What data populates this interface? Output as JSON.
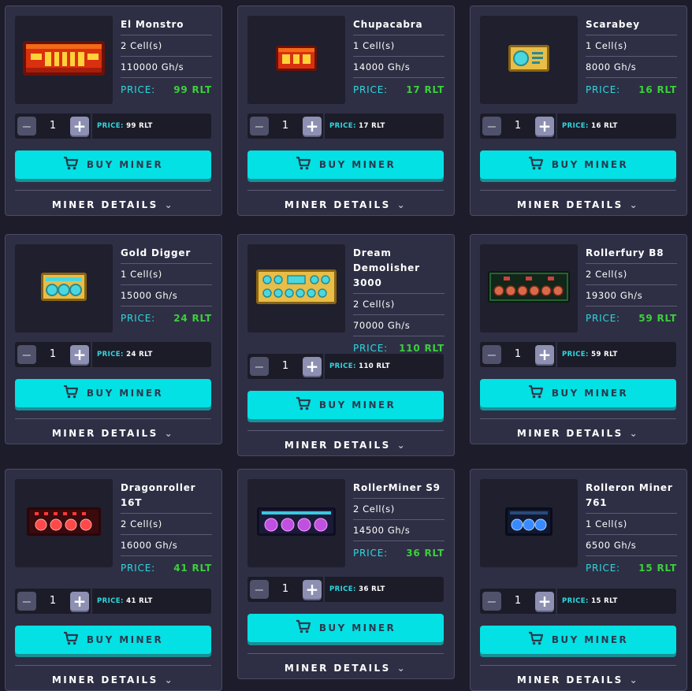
{
  "labels": {
    "price": "PRICE:",
    "buy": "BUY MINER",
    "details": "MINER DETAILS",
    "minus": "−",
    "plus": "+"
  },
  "miners": [
    {
      "name": "El Monstro",
      "cells": "2 Cell(s)",
      "power": "110000 Gh/s",
      "price": "99 RLT",
      "qty": "1",
      "icon": "red-gold-miner-icon"
    },
    {
      "name": "Chupacabra",
      "cells": "1 Cell(s)",
      "power": "14000 Gh/s",
      "price": "17 RLT",
      "qty": "1",
      "icon": "red-small-miner-icon"
    },
    {
      "name": "Scarabey",
      "cells": "1 Cell(s)",
      "power": "8000 Gh/s",
      "price": "16 RLT",
      "qty": "1",
      "icon": "gold-scarab-miner-icon"
    },
    {
      "name": "Gold Digger",
      "cells": "1 Cell(s)",
      "power": "15000 Gh/s",
      "price": "24 RLT",
      "qty": "1",
      "icon": "gold-fan-miner-icon"
    },
    {
      "name": "Dream Demolisher 3000",
      "cells": "2 Cell(s)",
      "power": "70000 Gh/s",
      "price": "110 RLT",
      "qty": "1",
      "icon": "gold-large-miner-icon"
    },
    {
      "name": "Rollerfury B8",
      "cells": "2 Cell(s)",
      "power": "19300 Gh/s",
      "price": "59 RLT",
      "qty": "1",
      "icon": "dark-green-miner-icon"
    },
    {
      "name": "Dragonroller 16T",
      "cells": "2 Cell(s)",
      "power": "16000 Gh/s",
      "price": "41 RLT",
      "qty": "1",
      "icon": "red-led-miner-icon"
    },
    {
      "name": "RollerMiner S9",
      "cells": "2 Cell(s)",
      "power": "14500 Gh/s",
      "price": "36 RLT",
      "qty": "1",
      "icon": "purple-fan-miner-icon"
    },
    {
      "name": "Rolleron Miner 761",
      "cells": "1 Cell(s)",
      "power": "6500 Gh/s",
      "price": "15 RLT",
      "qty": "1",
      "icon": "blue-fan-miner-icon"
    }
  ],
  "colors": {
    "accent": "#03e1e4",
    "price_label": "#2fd8e0",
    "price_value": "#3ccf3c",
    "card_bg": "#2e2f44",
    "page_bg": "#1c1c2b"
  }
}
